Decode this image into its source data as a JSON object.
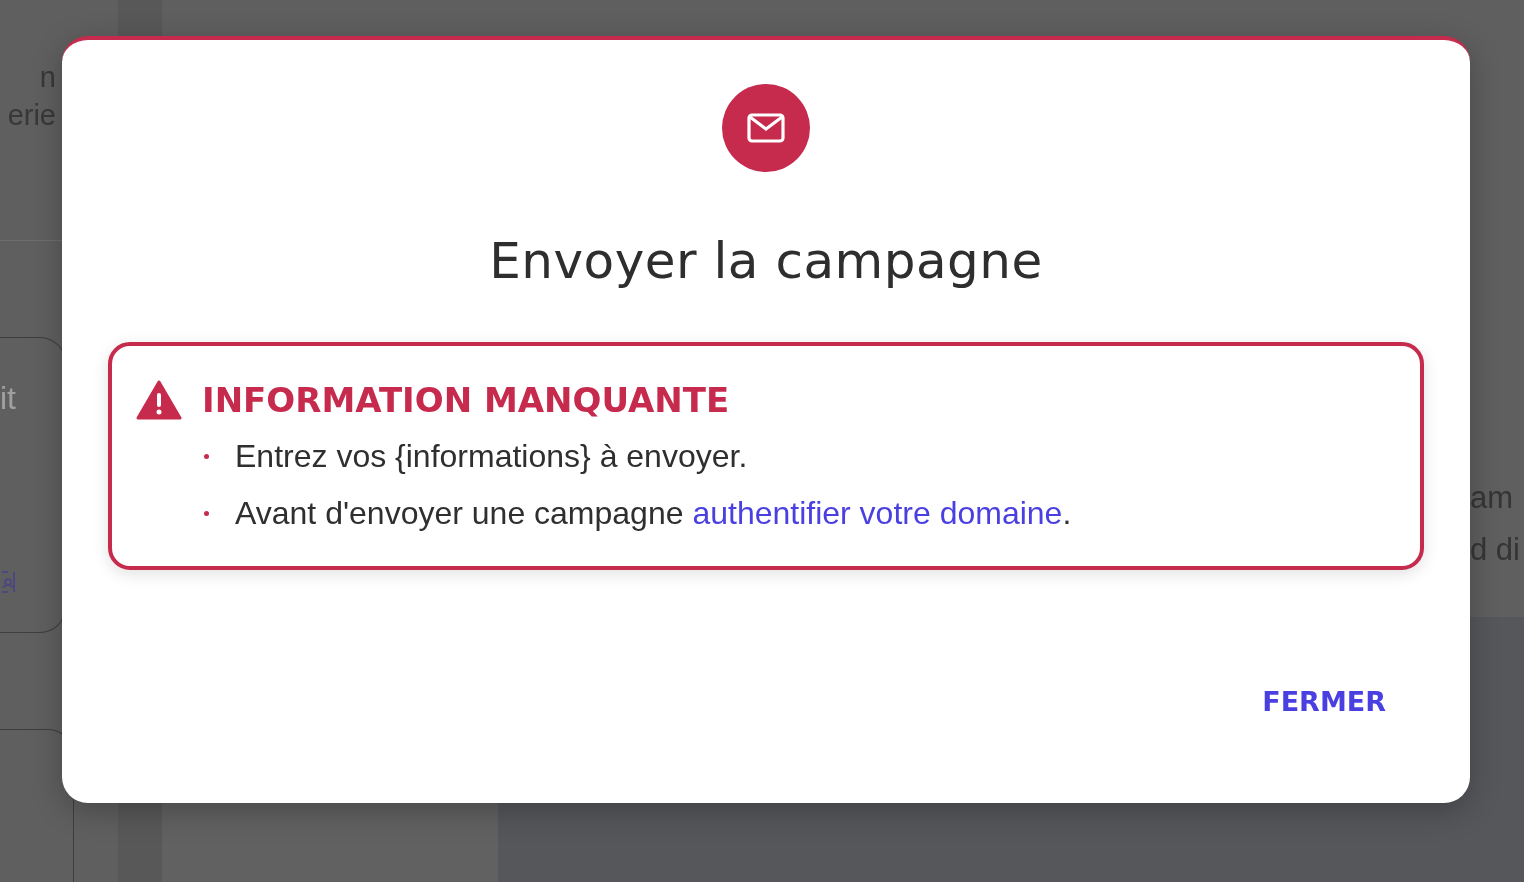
{
  "background": {
    "left_lines": [
      "n",
      "erie"
    ],
    "card_text": "it",
    "right_lines": [
      "am",
      "d di"
    ]
  },
  "dialog": {
    "title": "Envoyer la campagne",
    "alert": {
      "heading": "INFORMATION MANQUANTE",
      "items": [
        {
          "text": "Entrez vos {informations} à envoyer."
        },
        {
          "text": "Avant d'envoyer une campagne ",
          "link": "authentifier votre domaine",
          "after": "."
        }
      ]
    },
    "close_button": "FERMER"
  }
}
